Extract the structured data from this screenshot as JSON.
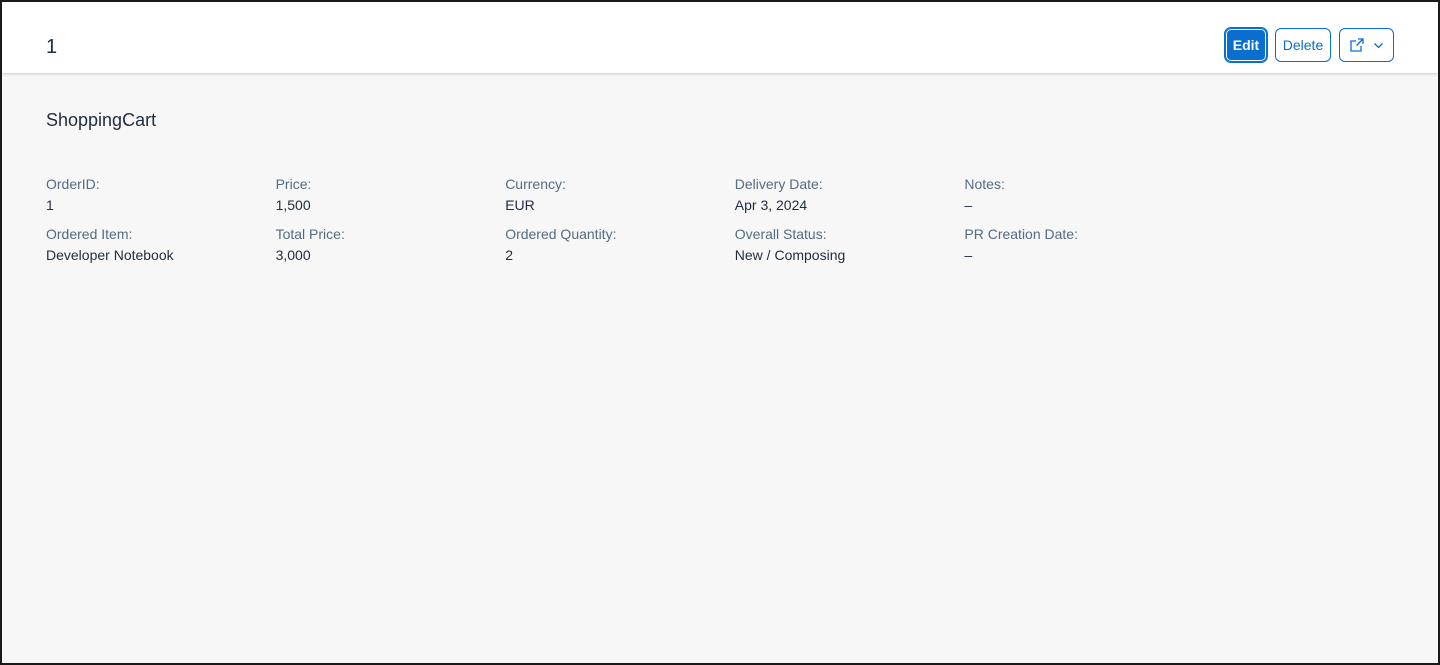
{
  "header": {
    "title": "1",
    "actions": {
      "edit_label": "Edit",
      "delete_label": "Delete",
      "share_icon": "share-icon",
      "dropdown_icon": "chevron-down-icon"
    }
  },
  "section": {
    "title": "ShoppingCart"
  },
  "fields": [
    {
      "label": "OrderID:",
      "value": "1"
    },
    {
      "label": "Price:",
      "value": "1,500"
    },
    {
      "label": "Currency:",
      "value": "EUR"
    },
    {
      "label": "Delivery Date:",
      "value": "Apr 3, 2024"
    },
    {
      "label": "Notes:",
      "value": "–"
    },
    {
      "label": "Ordered Item:",
      "value": "Developer Notebook"
    },
    {
      "label": "Total Price:",
      "value": "3,000"
    },
    {
      "label": "Ordered Quantity:",
      "value": "2"
    },
    {
      "label": "Overall Status:",
      "value": "New / Composing"
    },
    {
      "label": "PR Creation Date:",
      "value": "–"
    }
  ],
  "colors": {
    "accent": "#0a6ed1",
    "background": "#f7f7f7",
    "label": "#556b82",
    "text": "#1d2d3e"
  }
}
